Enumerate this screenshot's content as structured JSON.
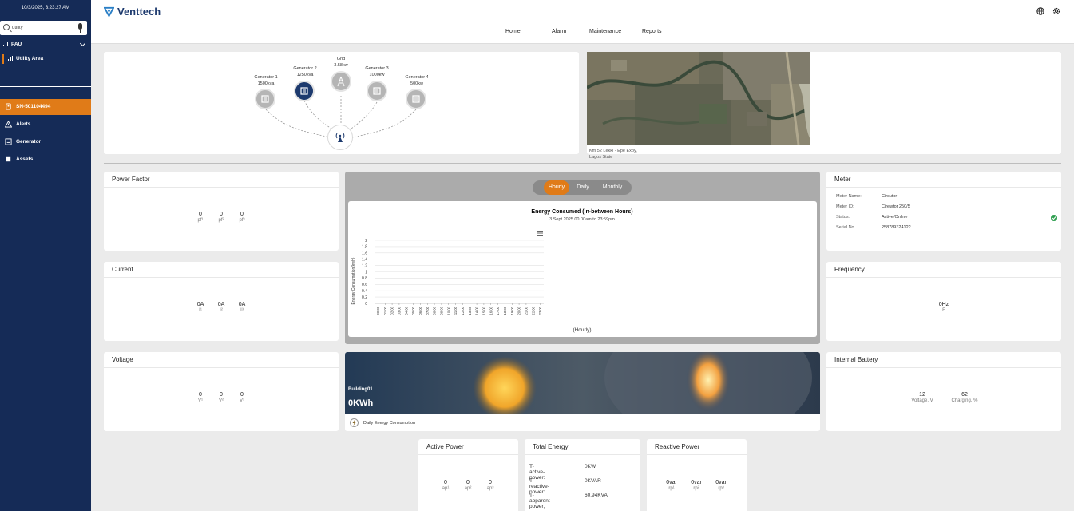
{
  "app": {
    "name": "Venttech"
  },
  "sidebar": {
    "datetime": "10/3/2025, 3:23:27 AM",
    "search_value": "utility",
    "group_label": "PAU",
    "area_label": "Utility Area",
    "nav": [
      {
        "label": "SN-501104494",
        "icon": "device-icon"
      },
      {
        "label": "Alerts",
        "icon": "warning-icon"
      },
      {
        "label": "Generator",
        "icon": "generator-icon"
      },
      {
        "label": "Assets",
        "icon": "assets-icon"
      }
    ]
  },
  "topnav": [
    "Home",
    "Alarm",
    "Maintenance",
    "Reports"
  ],
  "diagram": {
    "grid": {
      "name": "Grid",
      "rating": "3.58kw"
    },
    "generators": [
      {
        "name": "Generator 1",
        "rating": "1500kva"
      },
      {
        "name": "Generator 2",
        "rating": "1250kva"
      },
      {
        "name": "Generator 3",
        "rating": "1000kw"
      },
      {
        "name": "Generator 4",
        "rating": "500kw"
      }
    ]
  },
  "map": {
    "caption_line1": "Km 52 Lekki - Epe Expy,",
    "caption_line2": "Lagos State"
  },
  "power_factor": {
    "title": "Power Factor",
    "values": [
      "0",
      "0",
      "0"
    ],
    "labels": [
      "pf¹",
      "pf²",
      "pf³"
    ]
  },
  "current": {
    "title": "Current",
    "values": [
      "0A",
      "0A",
      "0A"
    ],
    "labels": [
      "I¹",
      "I²",
      "I³"
    ]
  },
  "voltage": {
    "title": "Voltage",
    "values": [
      "0",
      "0",
      "0"
    ],
    "labels": [
      "V¹",
      "V²",
      "V³"
    ]
  },
  "meter": {
    "title": "Meter",
    "rows": [
      {
        "key": "Meter Name:",
        "value": "Circutor"
      },
      {
        "key": "Meter ID:",
        "value": "Cirewtor 250/5"
      },
      {
        "key": "Status:",
        "value": "Active/Online"
      },
      {
        "key": "Serial No.",
        "value": "258789324122"
      }
    ],
    "status_color": "#2e9e4f"
  },
  "frequency": {
    "title": "Frequency",
    "value": "0Hz",
    "label": "F"
  },
  "battery": {
    "title": "Internal Battery",
    "values": [
      "12",
      "62"
    ],
    "labels": [
      "Voltage, V",
      "Charging, %"
    ]
  },
  "energy_tabs": {
    "options": [
      "Hourly",
      "Daily",
      "Monthly"
    ],
    "selected": "Hourly"
  },
  "building": {
    "name": "Building01",
    "value": "0KWh",
    "caption": "Daily Energy Consumption"
  },
  "active_power": {
    "title": "Active Power",
    "values": [
      "0",
      "0",
      "0"
    ],
    "labels": [
      "ap¹",
      "ap²",
      "ap³"
    ]
  },
  "total_energy": {
    "title": "Total Energy",
    "rows": [
      {
        "key": "T- active-power:",
        "value": "0KW"
      },
      {
        "key": "T-reactive-power:",
        "value": "0KVAR"
      },
      {
        "key": "T-apparent-power,",
        "value": "60.94KVA"
      }
    ]
  },
  "reactive_power": {
    "title": "Reactive Power",
    "values": [
      "0var",
      "0var",
      "0var"
    ],
    "labels": [
      "rp¹",
      "rp²",
      "rp³"
    ]
  },
  "chart_data": {
    "type": "line",
    "title": "Energy Consumed (In-between Hours)",
    "subtitle": "3 Sept 2025 00.00am to 23:59pm",
    "xlabel": "(Hourly)",
    "ylabel": "Energy Consumption(kwh)",
    "categories": [
      "00:00",
      "01:00",
      "02:00",
      "03:00",
      "04:00",
      "05:00",
      "06:00",
      "07:00",
      "08:00",
      "09:00",
      "10:00",
      "11:00",
      "12:00",
      "13:00",
      "14:00",
      "15:00",
      "16:00",
      "17:00",
      "18:00",
      "19:00",
      "20:00",
      "21:00",
      "22:00",
      "23:00"
    ],
    "yticks": [
      "0",
      "0.2",
      "0.4",
      "0.6",
      "0.8",
      "1",
      "1.2",
      "1.4",
      "1.6",
      "1.8",
      "2"
    ],
    "ylim": [
      0,
      2
    ],
    "grid": true,
    "series": []
  }
}
